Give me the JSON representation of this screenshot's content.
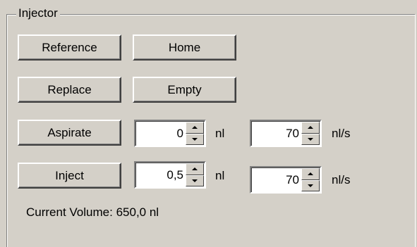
{
  "group": {
    "title": "Injector"
  },
  "buttons": {
    "reference": "Reference",
    "home": "Home",
    "replace": "Replace",
    "empty": "Empty",
    "aspirate": "Aspirate",
    "inject": "Inject"
  },
  "aspirate": {
    "volume": "0",
    "volume_unit": "nl",
    "speed": "70",
    "speed_unit": "nl/s"
  },
  "inject": {
    "volume": "0,5",
    "volume_unit": "nl",
    "speed": "70",
    "speed_unit": "nl/s"
  },
  "status": {
    "current_volume_label": "Current Volume:",
    "current_volume_value": "650,0 nl"
  }
}
